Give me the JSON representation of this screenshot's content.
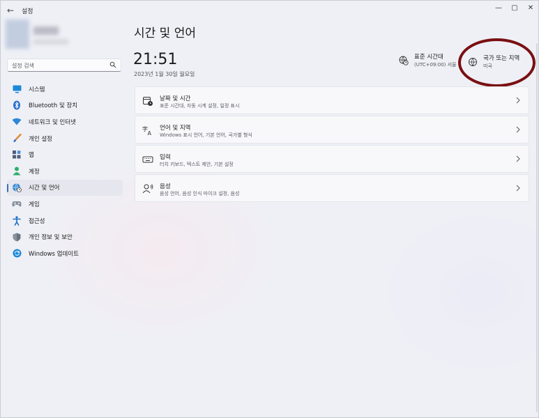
{
  "app": {
    "title": "설정",
    "back_icon": "back-arrow-icon"
  },
  "window_controls": {
    "minimize": "—",
    "maximize": "▢",
    "close": "✕"
  },
  "search": {
    "placeholder": "설정 검색"
  },
  "sidebar": {
    "items": [
      {
        "label": "시스템",
        "icon": "monitor-icon"
      },
      {
        "label": "Bluetooth 및 장치",
        "icon": "bluetooth-icon"
      },
      {
        "label": "네트워크 및 인터넷",
        "icon": "wifi-icon"
      },
      {
        "label": "개인 설정",
        "icon": "brush-icon"
      },
      {
        "label": "앱",
        "icon": "apps-icon"
      },
      {
        "label": "계정",
        "icon": "person-icon"
      },
      {
        "label": "시간 및 언어",
        "icon": "globe-clock-icon",
        "active": true
      },
      {
        "label": "게임",
        "icon": "gamepad-icon"
      },
      {
        "label": "접근성",
        "icon": "accessibility-icon"
      },
      {
        "label": "개인 정보 및 보안",
        "icon": "shield-icon"
      },
      {
        "label": "Windows 업데이트",
        "icon": "update-icon"
      }
    ]
  },
  "main": {
    "title": "시간 및 언어",
    "clock": "21:51",
    "date": "2023년 1월 30일 월요일",
    "timezone": {
      "title": "표준 시간대",
      "value": "(UTC+09:00) 서울"
    },
    "region": {
      "title": "국가 또는 지역",
      "value": "미국"
    },
    "cards": [
      {
        "title": "날짜 및 시간",
        "subtitle": "표준 시간대, 자동 시계 설정, 일정 표시",
        "icon": "calendar-clock-icon"
      },
      {
        "title": "언어 및 지역",
        "subtitle": "Windows 표시 언어, 기본 언어, 국가별 형식",
        "icon": "language-icon"
      },
      {
        "title": "입력",
        "subtitle": "터치 키보드, 텍스트 제안, 기본 설정",
        "icon": "keyboard-icon"
      },
      {
        "title": "음성",
        "subtitle": "음성 언어, 음성 인식 마이크 설정, 음성",
        "icon": "speech-icon"
      }
    ]
  },
  "colors": {
    "accent": "#3c6fb6",
    "highlight_ring": "#7a0f12"
  }
}
